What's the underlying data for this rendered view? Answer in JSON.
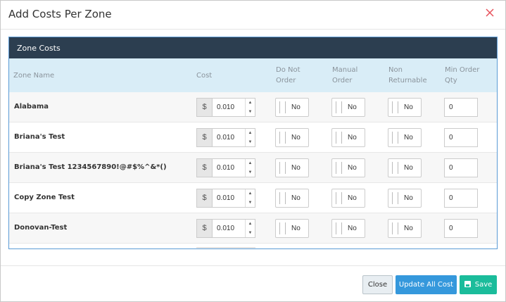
{
  "dialog": {
    "title": "Add Costs Per Zone"
  },
  "panel": {
    "heading": "Zone Costs",
    "columns": {
      "zone_name": "Zone Name",
      "cost": "Cost",
      "do_not_order_1": "Do Not",
      "do_not_order_2": "Order",
      "manual_order_1": "Manual",
      "manual_order_2": "Order",
      "non_returnable_1": "Non",
      "non_returnable_2": "Returnable",
      "min_order_qty_1": "Min Order",
      "min_order_qty_2": "Qty"
    },
    "rows": [
      {
        "zone": "Alabama",
        "currency": "$",
        "cost": "0.010",
        "do_not_order": "No",
        "manual_order": "No",
        "non_returnable": "No",
        "min_qty": "0"
      },
      {
        "zone": "Briana's Test",
        "currency": "$",
        "cost": "0.010",
        "do_not_order": "No",
        "manual_order": "No",
        "non_returnable": "No",
        "min_qty": "0"
      },
      {
        "zone": "Briana's Test 1234567890!@#$%^&*()",
        "currency": "$",
        "cost": "0.010",
        "do_not_order": "No",
        "manual_order": "No",
        "non_returnable": "No",
        "min_qty": "0"
      },
      {
        "zone": "Copy Zone Test",
        "currency": "$",
        "cost": "0.010",
        "do_not_order": "No",
        "manual_order": "No",
        "non_returnable": "No",
        "min_qty": "0"
      },
      {
        "zone": "Donovan-Test",
        "currency": "$",
        "cost": "0.010",
        "do_not_order": "No",
        "manual_order": "No",
        "non_returnable": "No",
        "min_qty": "0"
      }
    ]
  },
  "footer": {
    "close_label": "Close",
    "update_label": "Update All Cost",
    "save_label": "Save"
  },
  "colors": {
    "panel_header": "#2c3e50",
    "table_header": "#d9edf7",
    "update_button": "#3598dc",
    "save_button": "#1bbc9b",
    "close_icon": "#e7505a"
  },
  "icons": {
    "close": "close-icon",
    "save": "floppy-disk-icon",
    "spinner": "spinner-arrows-icon"
  }
}
